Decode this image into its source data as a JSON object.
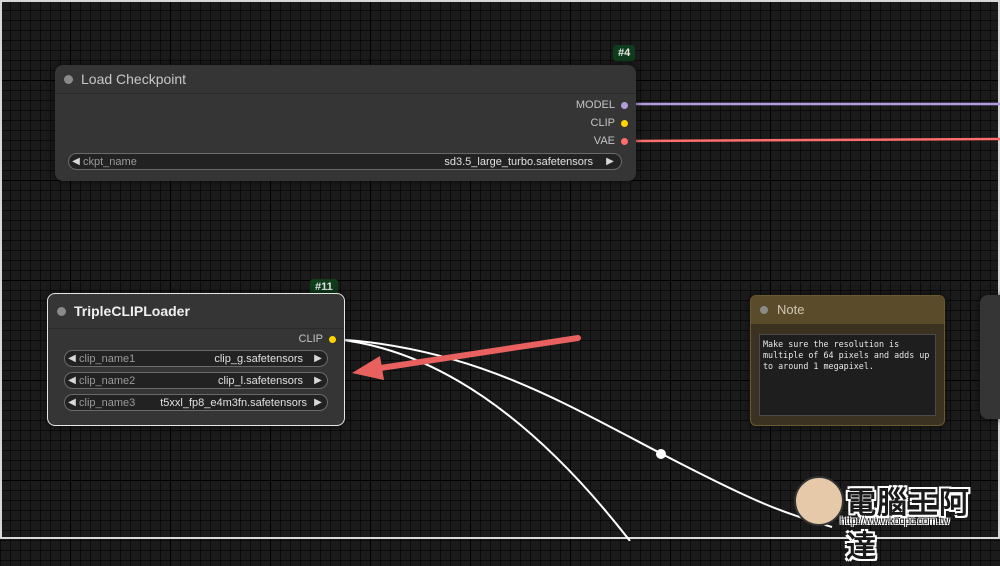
{
  "nodes": {
    "load_checkpoint": {
      "id_badge": "#4",
      "title": "Load Checkpoint",
      "outputs": [
        {
          "label": "MODEL",
          "color": "#b39ddb"
        },
        {
          "label": "CLIP",
          "color": "#ffd500"
        },
        {
          "label": "VAE",
          "color": "#ff6e6e"
        }
      ],
      "widget": {
        "name": "ckpt_name",
        "value": "sd3.5_large_turbo.safetensors"
      }
    },
    "triple_clip_loader": {
      "id_badge": "#11",
      "title": "TripleCLIPLoader",
      "output": {
        "label": "CLIP",
        "color": "#ffd500"
      },
      "widgets": [
        {
          "name": "clip_name1",
          "value": "clip_g.safetensors"
        },
        {
          "name": "clip_name2",
          "value": "clip_l.safetensors"
        },
        {
          "name": "clip_name3",
          "value": "t5xxl_fp8_e4m3fn.safetensors"
        }
      ]
    },
    "note": {
      "title": "Note",
      "text": "Make sure the resolution is multiple of 64 pixels and adds up to around 1 megapixel."
    }
  },
  "watermark": {
    "text": "電腦王阿達",
    "url": "http://www.kocpc.com.tw"
  },
  "colors": {
    "model_link": "#b39ddb",
    "vae_link": "#ff6e6e",
    "clip_link": "#ffffff",
    "arrow": "#e8615f"
  },
  "icons": {
    "left": "◀",
    "right": "▶"
  }
}
